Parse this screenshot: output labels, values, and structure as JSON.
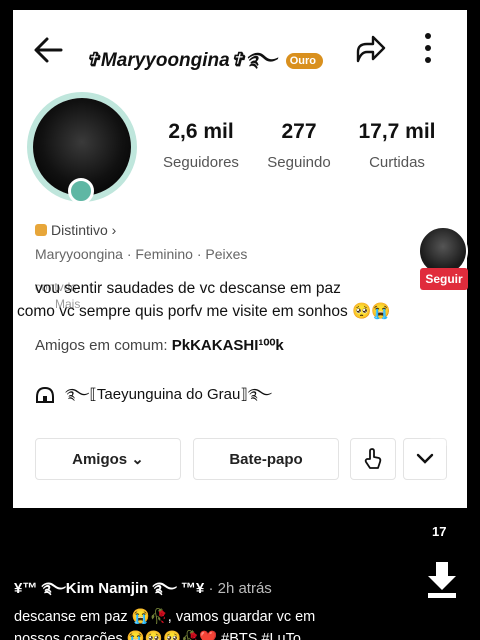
{
  "header": {
    "title": "✞Maryyoongina✞࿐",
    "badge": "Ouro"
  },
  "stats": [
    {
      "value": "2,6 mil",
      "label": "Seguidores"
    },
    {
      "value": "277",
      "label": "Seguindo"
    },
    {
      "value": "17,7 mil",
      "label": "Curtidas"
    }
  ],
  "profile": {
    "distintivo": "Distintivo ›",
    "meta": "Maryyoongina · Feminino · Peixes",
    "bio_line1": "vou sentir saudades de vc descanse em paz",
    "bio_line2": "como vc sempre quis porfv me visite em sonhos 🥺😭",
    "ghost_left1": "contvdc",
    "ghost_left2": "Mais",
    "friends_label": "Amigos em comum:",
    "friends_value": "PkKAKASHI¹⁰⁰k",
    "community": "࿐⟦Taeyunguina do Grau⟧࿐"
  },
  "buttons": {
    "amigos": "Amigos ⌄",
    "batepapo": "Bate-papo"
  },
  "overlay": {
    "follow": "Seguir",
    "count": "17"
  },
  "comment": {
    "user": "¥™ ࿐Kim Namjin ࿐ ™¥",
    "time": " · 2h atrás",
    "line1": "descanse em paz 😭🥀, vamos guardar vc em",
    "line2": "nossos corações 😭🥺🥺🥀❤️ #BTS #LuTo"
  },
  "colors": {
    "accent": "#e02c3c",
    "badge": "#d9901e",
    "ring": "#bfe6dc"
  }
}
